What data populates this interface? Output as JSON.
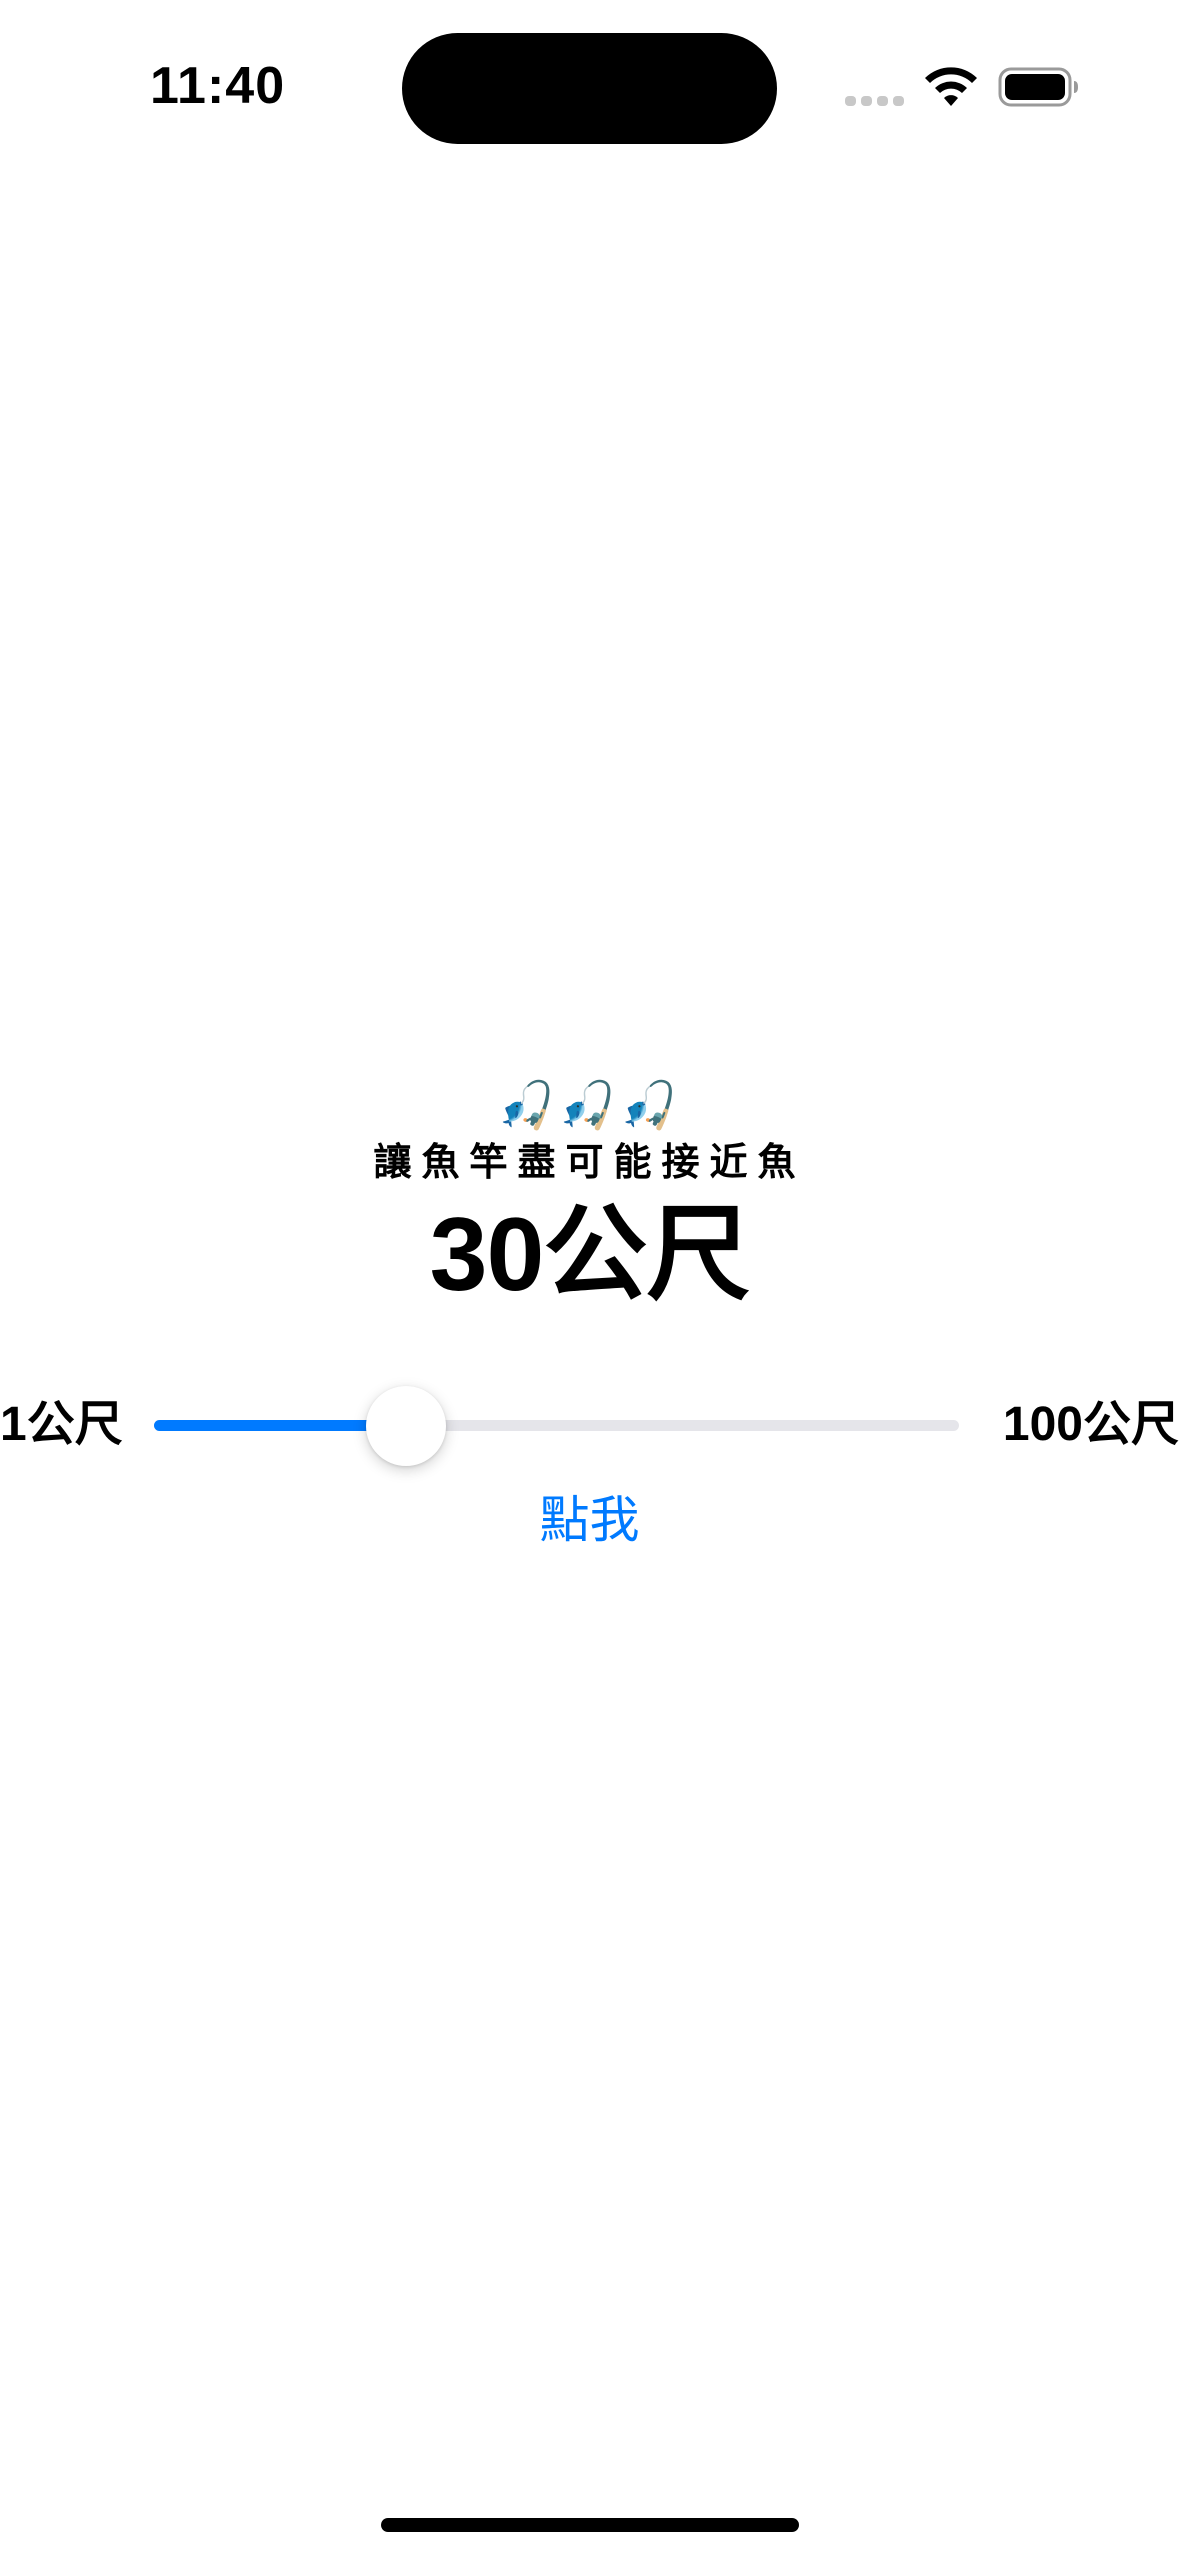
{
  "status_bar": {
    "time": "11:40",
    "wifi_icon": "wifi-icon",
    "battery_icon": "battery-icon",
    "signal_icon": "cellular-signal-icon"
  },
  "main": {
    "emoji_row": "🎣🎣🎣",
    "subtitle": "讓魚竿盡可能接近魚",
    "distance": "30公尺"
  },
  "slider": {
    "min_label": "1公尺",
    "max_label": "100公尺",
    "min": 1,
    "max": 100,
    "value": 30,
    "accent_color": "#007aff",
    "track_color": "#e5e5ea"
  },
  "button": {
    "label": "點我"
  }
}
